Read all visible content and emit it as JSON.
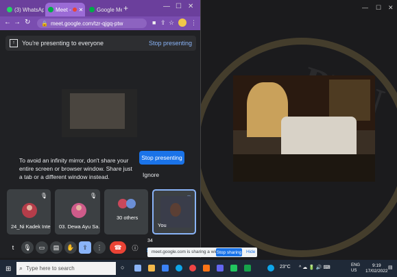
{
  "browser": {
    "tabs": [
      {
        "label": "(3) WhatsAp",
        "active": false
      },
      {
        "label": "Meet - ",
        "active": true
      },
      {
        "label": "Google Meet",
        "active": false
      }
    ],
    "url": "meet.google.com/tzr-qjgq-ptw"
  },
  "meet": {
    "present_bar": {
      "text": "You're presenting to everyone",
      "stop_label": "Stop presenting"
    },
    "mirror_warning": "To avoid an infinity mirror, don't share your entire screen or browser window. Share just a tab or a different window instead.",
    "stop_presenting_button": "Stop presenting",
    "ignore_label": "Ignore",
    "tiles": [
      {
        "name": "24_Ni Kadek Inte..."
      },
      {
        "name": "03. Dewa Ayu Sa..."
      },
      {
        "name": "30 others"
      },
      {
        "name": "You"
      }
    ],
    "participant_count": "34"
  },
  "share_notice": {
    "text": "meet.google.com is sharing a window.",
    "stop_label": "Stop sharing",
    "hide_label": "Hide"
  },
  "taskbar": {
    "search_placeholder": "Type here to search",
    "weather": "23°C",
    "language": "ENG",
    "region": "US",
    "time": "9:19",
    "date": "17/02/2022"
  },
  "colors": {
    "browser_frame": "#6b3f9c",
    "meet_background": "#202124",
    "accent": "#1a73e8",
    "hang_up": "#ea4335"
  }
}
